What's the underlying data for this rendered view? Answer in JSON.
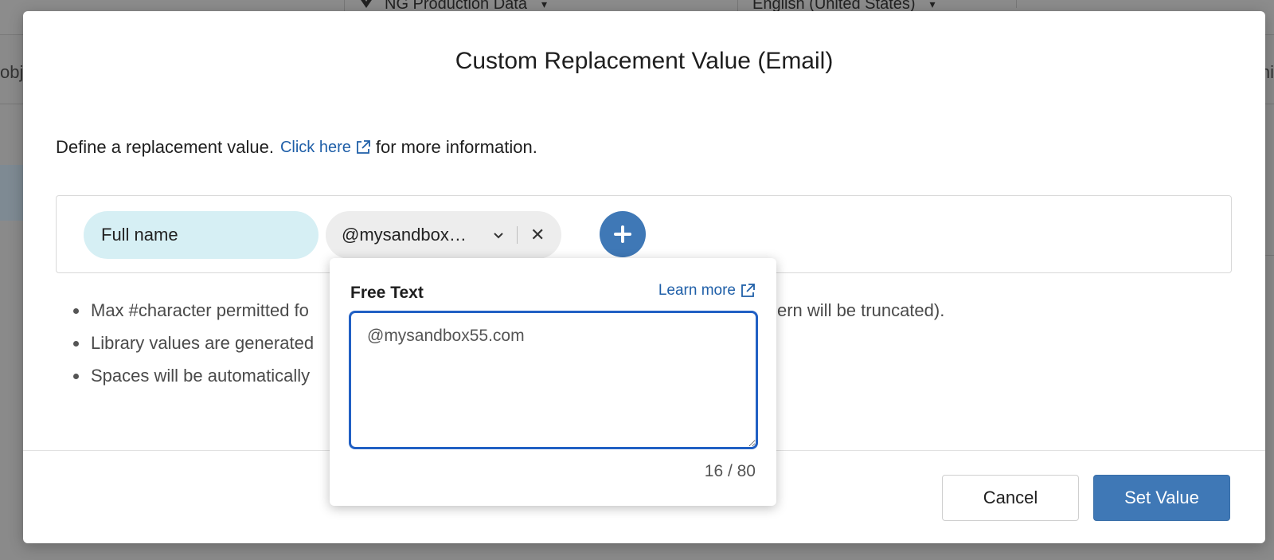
{
  "background": {
    "datasource_label": "NG Production Data",
    "language_label": "English (United States)",
    "left_clip_text": "obj",
    "right_clip_text": "hi"
  },
  "modal": {
    "title": "Custom Replacement Value (Email)",
    "intro_text": "Define a replacement value.",
    "intro_link": "Click here",
    "intro_suffix": "for more information.",
    "chips": {
      "full_name": "Full name",
      "email_value": "@mysandbox…"
    },
    "rules": [
      "Max #character permitted fo",
      "Library values are generated",
      "Spaces will be automatically"
    ],
    "rules_right": "ern will be truncated).",
    "buttons": {
      "cancel": "Cancel",
      "set_value": "Set Value"
    }
  },
  "popover": {
    "title": "Free Text",
    "learn_more": "Learn more",
    "textarea_value": "@mysandbox55.com",
    "counter": "16 / 80"
  },
  "colors": {
    "accent": "#3f78b6",
    "link": "#1f5fa8",
    "chip_fullname_bg": "#d6eff4",
    "chip_email_bg": "#ededed",
    "focus_border": "#2160c4"
  }
}
